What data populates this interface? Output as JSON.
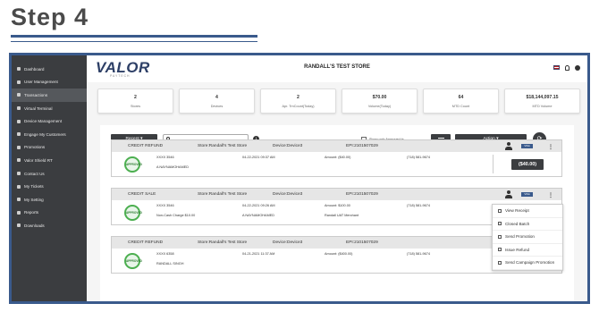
{
  "step_title": "Step 4",
  "sidebar": {
    "items": [
      {
        "label": "Dashboard",
        "icon": "dashboard-icon"
      },
      {
        "label": "User Management",
        "icon": "users-icon"
      },
      {
        "label": "Transactions",
        "icon": "transactions-icon",
        "active": true
      },
      {
        "label": "Virtual Terminal",
        "icon": "terminal-icon"
      },
      {
        "label": "Device Management",
        "icon": "device-icon"
      },
      {
        "label": "Engage My Customers",
        "icon": "engage-icon"
      },
      {
        "label": "Promotions",
        "icon": "promotions-icon"
      },
      {
        "label": "Valor Shield RT",
        "icon": "shield-icon"
      },
      {
        "label": "Contact Us",
        "icon": "contact-icon"
      },
      {
        "label": "My Tickets",
        "icon": "tickets-icon"
      },
      {
        "label": "My Setting",
        "icon": "settings-icon"
      },
      {
        "label": "Reports",
        "icon": "reports-icon"
      },
      {
        "label": "Downloads",
        "icon": "downloads-icon"
      }
    ]
  },
  "header": {
    "logo": "VALOR",
    "logo_sub": "PAYTECH",
    "store_name": "RANDALL'S TEST STORE"
  },
  "stats": [
    {
      "value": "2",
      "label": "Stores"
    },
    {
      "value": "4",
      "label": "Devices"
    },
    {
      "value": "2",
      "label": "Apr. TrnCount(Today)"
    },
    {
      "value": "$70.00",
      "label": "Volume(Today)"
    },
    {
      "value": "64",
      "label": "MTD Count"
    },
    {
      "value": "$18,144,097.15",
      "label": "MTD Volume"
    }
  ],
  "toolbar": {
    "recent_label": "Recent ▾",
    "search_placeholder": "",
    "approved_only_label": "Show only Approved tx",
    "action_label": "Action ▾"
  },
  "transactions": [
    {
      "type": "CREDIT REFUND",
      "store": "Store:Randall's Test Store",
      "device": "Device:Device3",
      "epi": "EPI:2101507029",
      "card": "XXXX 3546",
      "name": "A NAYNAMOHAMED",
      "date": "04-22-2021 09:37 AM",
      "amount": "Amount: ($40.00)",
      "phone": "(718) 581-9674",
      "extra": "",
      "merchant": "",
      "badge": "($40.00)",
      "approved_stamp": "APPROVED"
    },
    {
      "type": "CREDIT SALE",
      "store": "Store:Randall's Test Store",
      "device": "Device:Device3",
      "epi": "EPI:2101507029",
      "card": "XXXX 3546",
      "name": "A NAYNAMOHAMED",
      "date": "04-22-2021 09:26 AM",
      "amount": "Amount: $100.00",
      "phone": "(718) 581-9674",
      "extra": "Non-Cash Charge $10.00",
      "merchant": "Randall UAT Merchant",
      "badge": "",
      "approved_stamp": "APPROVED"
    },
    {
      "type": "CREDIT REFUND",
      "store": "Store:Randall's Test Store",
      "device": "Device:Device3",
      "epi": "EPI:2101507029",
      "card": "XXXX 6358",
      "name": "RANDALL SINGH",
      "date": "04-21-2021 11:37 AM",
      "amount": "Amount: ($400.00)",
      "phone": "(718) 581-9674",
      "extra": "",
      "merchant": "",
      "badge": "",
      "approved_stamp": "APPROVED"
    }
  ],
  "context_menu": [
    {
      "label": "View Receipt",
      "icon": "receipt-icon"
    },
    {
      "label": "Closed Batch",
      "icon": "batch-icon"
    },
    {
      "label": "Send Promotion",
      "icon": "promotion-icon"
    },
    {
      "label": "Issue Refund",
      "icon": "refund-icon"
    },
    {
      "label": "Send Campaign Promotion",
      "icon": "campaign-icon"
    }
  ]
}
